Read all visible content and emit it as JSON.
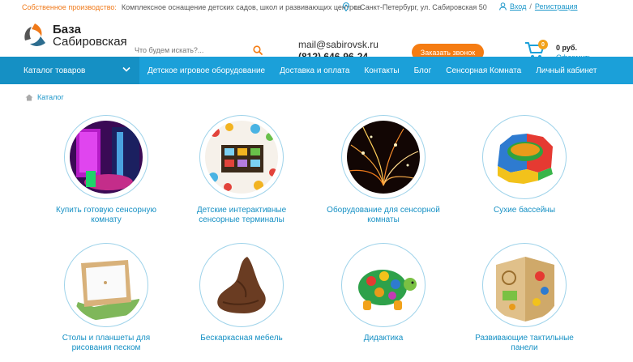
{
  "topbar": {
    "prod_label": "Собственное производство:",
    "prod_text": "Комплексное оснащение детских садов, школ и развивающих центров",
    "address": "г. Санкт-Петербург, ул. Сабировская 50",
    "login": "Вход",
    "sep": "/",
    "register": "Регистрация"
  },
  "logo": {
    "line1": "База",
    "line2": "Сабировская"
  },
  "search": {
    "placeholder": "Что будем искать?..."
  },
  "contact": {
    "email": "mail@sabirovsk.ru",
    "phone": "(812) 646-96-24"
  },
  "callback": "Заказать звонок",
  "cart": {
    "count": "0",
    "sum": "0 руб.",
    "order": "Оформить"
  },
  "nav": {
    "catalog": "Каталог товаров",
    "items": [
      "Детское игровое оборудование",
      "Доставка и оплата",
      "Контакты",
      "Блог",
      "Сенсорная Комната",
      "Личный кабинет"
    ]
  },
  "breadcrumb": {
    "label": "Каталог"
  },
  "categories": [
    {
      "label": "Купить готовую сенсорную комнату",
      "icon": "sensory-room-photo"
    },
    {
      "label": "Детские интерактивные сенсорные терминалы",
      "icon": "interactive-terminal-photo"
    },
    {
      "label": "Оборудование для сенсорной комнаты",
      "icon": "fiber-optic-photo"
    },
    {
      "label": "Сухие бассейны",
      "icon": "dry-pool-photo"
    },
    {
      "label": "Столы и планшеты для рисования песком",
      "icon": "sand-table-photo"
    },
    {
      "label": "Бескаркасная мебель",
      "icon": "bean-bag-photo"
    },
    {
      "label": "Дидактика",
      "icon": "turtle-toy-photo"
    },
    {
      "label": "Развивающие тактильные панели",
      "icon": "tactile-panel-photo"
    }
  ],
  "colors": {
    "accent": "#1ba0d9",
    "orange": "#f57c12",
    "link": "#1b96c9"
  }
}
